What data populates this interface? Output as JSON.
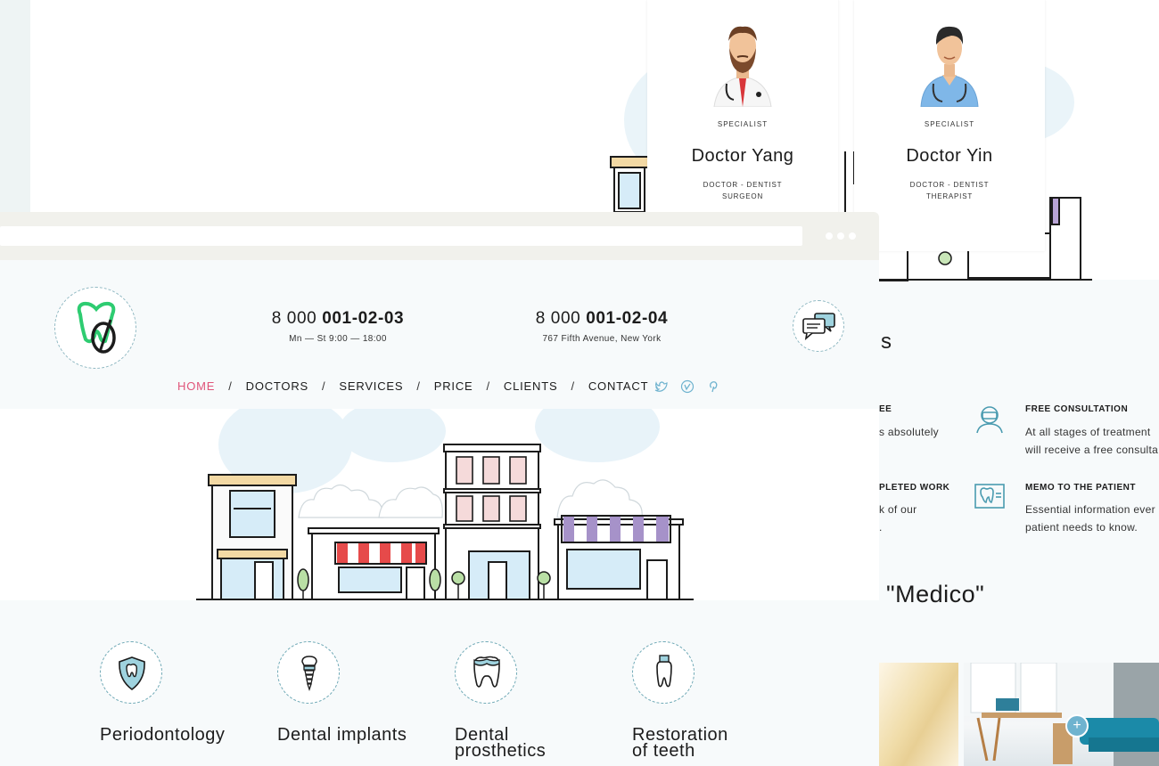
{
  "doctors": [
    {
      "specialty": "SPECIALIST",
      "name": "Doctor Yang",
      "role": "DOCTOR - DENTIST\nSURGEON"
    },
    {
      "specialty": "SPECIALIST",
      "name": "Doctor Yin",
      "role": "DOCTOR - DENTIST\nTHERAPIST"
    }
  ],
  "header": {
    "phone1_prefix": "8 000 ",
    "phone1_number": "001-02-03",
    "phone1_sub": "Mn — St 9:00 — 18:00",
    "phone2_prefix": "8 000 ",
    "phone2_number": "001-02-04",
    "phone2_sub": "767 Fifth Avenue, New York"
  },
  "nav": {
    "items": [
      "HOME",
      "DOCTORS",
      "SERVICES",
      "PRICE",
      "CLIENTS",
      "CONTACT"
    ],
    "separator": "/"
  },
  "socials": [
    "twitter-icon",
    "vimeo-icon",
    "pinterest-icon"
  ],
  "services": [
    {
      "label": "Periodontology",
      "icon": "shield-tooth-icon"
    },
    {
      "label": "Dental implants",
      "icon": "implant-icon"
    },
    {
      "label": "Dental\nprosthetics",
      "icon": "crown-tooth-icon"
    },
    {
      "label": "Restoration\nof teeth",
      "icon": "restored-tooth-icon"
    }
  ],
  "right_page": {
    "title_fragment": "s",
    "features": [
      {
        "title": "EE",
        "text": "s absolutely"
      },
      {
        "title": "FREE CONSULTATION",
        "text": "At all stages of treatment\nwill receive a free consulta"
      },
      {
        "title": "PLETED WORK",
        "text": "k of our\n."
      },
      {
        "title": "MEMO TO THE PATIENT",
        "text": "Essential information ever\npatient needs to know."
      }
    ],
    "medico": "\"Medico\"",
    "plus_label": "+"
  },
  "colors": {
    "accent_pink": "#e0557a",
    "logo_green": "#2ecc71",
    "icon_teal": "#2f6f80",
    "awning_red": "#e64a4a",
    "awning_purple": "#a692c9",
    "page_bg": "#f7fafb"
  }
}
